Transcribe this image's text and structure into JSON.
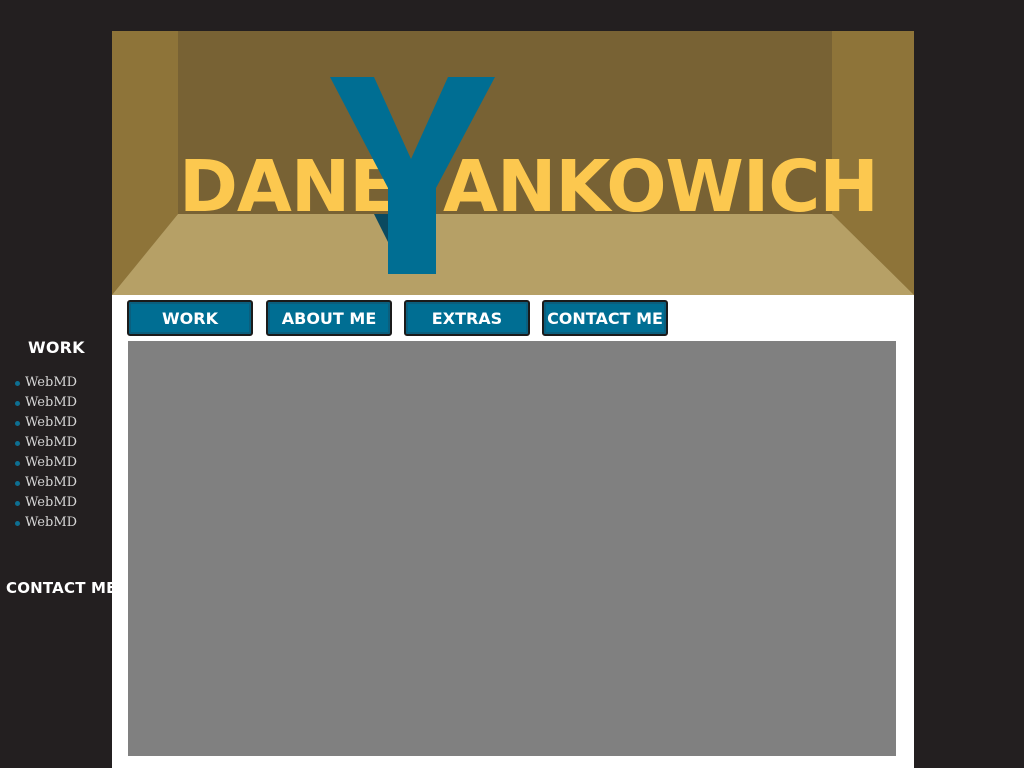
{
  "header": {
    "logo_first": "DANE",
    "logo_y": "Y",
    "logo_rest": "ANKOWICH"
  },
  "nav": {
    "items": [
      {
        "label": "WORK"
      },
      {
        "label": "ABOUT ME"
      },
      {
        "label": "EXTRAS"
      },
      {
        "label": "CONTACT ME"
      }
    ]
  },
  "sidebar": {
    "work_heading": "WORK",
    "items": [
      {
        "label": "WebMD"
      },
      {
        "label": "WebMD"
      },
      {
        "label": "WebMD"
      },
      {
        "label": "WebMD"
      },
      {
        "label": "WebMD"
      },
      {
        "label": "WebMD"
      },
      {
        "label": "WebMD"
      },
      {
        "label": "WebMD"
      }
    ],
    "contact_heading": "CONTACT ME"
  },
  "colors": {
    "page_background": "#231f20",
    "panel_background": "#ffffff",
    "logo_yellow": "#fcc84f",
    "brand_blue": "#006e93",
    "banner_back_wall": "#786234",
    "banner_side_wall": "#8e7439",
    "banner_floor": "#b6a066",
    "content_placeholder": "#808080",
    "bullet": "#0e6f91"
  },
  "icons": {
    "sidebar_bullet": "bullet-dot-icon"
  }
}
